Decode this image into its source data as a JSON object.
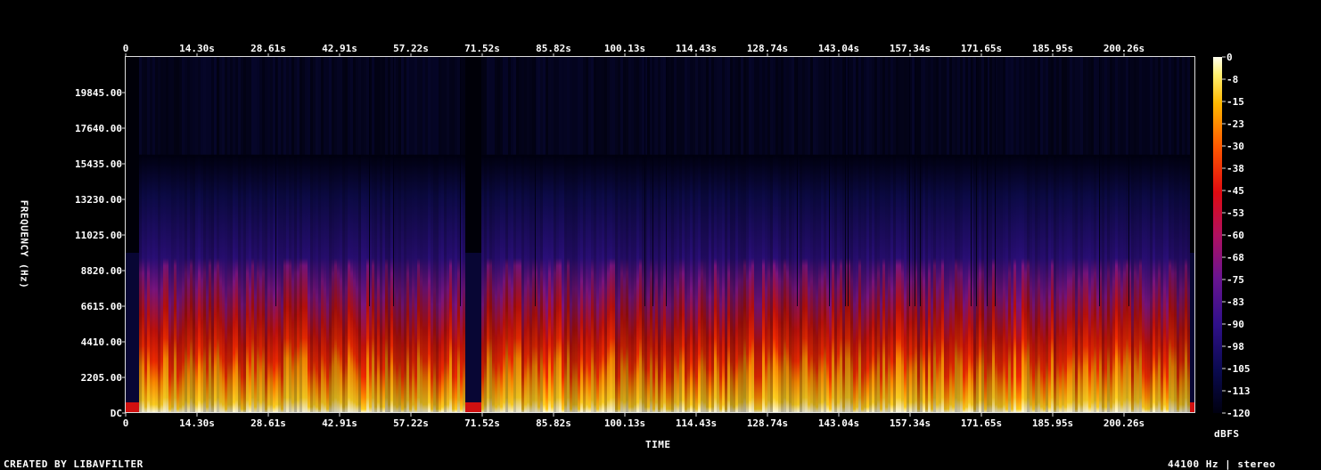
{
  "chart_data": {
    "type": "heatmap",
    "x_axis": {
      "label": "TIME",
      "ticks": [
        "0",
        "14.30s",
        "28.61s",
        "42.91s",
        "57.22s",
        "71.52s",
        "85.82s",
        "100.13s",
        "114.43s",
        "128.74s",
        "143.04s",
        "157.34s",
        "171.65s",
        "185.95s",
        "200.26s"
      ],
      "range": [
        0,
        214.5
      ]
    },
    "y_axis": {
      "label": "FREQUENCY (Hz)",
      "ticks": [
        "DC",
        "2205.00",
        "4410.00",
        "6615.00",
        "8820.00",
        "11025.00",
        "13230.00",
        "15435.00",
        "17640.00",
        "19845.00"
      ],
      "range": [
        0,
        22050
      ]
    },
    "colorbar": {
      "label": "dBFS",
      "ticks": [
        "0",
        "-8",
        "-15",
        "-23",
        "-30",
        "-38",
        "-45",
        "-53",
        "-60",
        "-68",
        "-75",
        "-83",
        "-90",
        "-98",
        "-105",
        "-113",
        "-120"
      ],
      "range": [
        -120,
        0
      ]
    },
    "energy_cutoff_hz": 16000,
    "quiet_regions_s": [
      [
        0,
        2.5
      ],
      [
        68,
        71
      ],
      [
        213,
        214.5
      ]
    ]
  },
  "footer": {
    "credit": "CREATED BY LIBAVFILTER",
    "info": "44100 Hz | stereo"
  },
  "colors": {
    "background": "#000000",
    "low": "#000018",
    "mid": "#e00000",
    "high": "#fffff0"
  }
}
